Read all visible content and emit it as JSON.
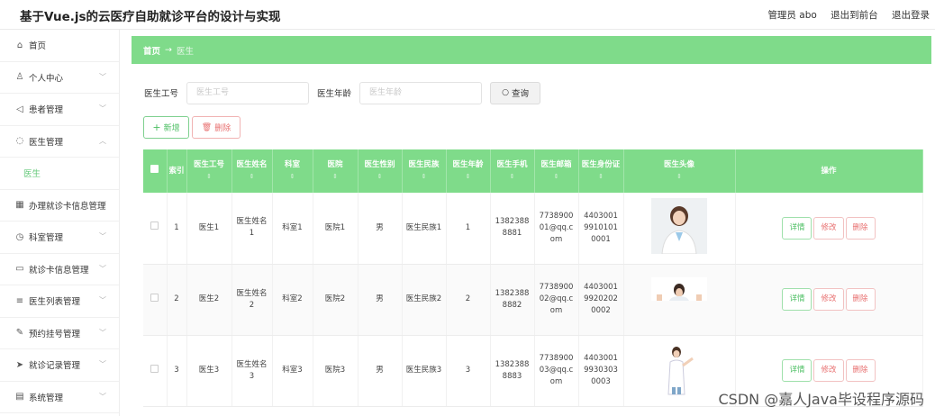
{
  "header": {
    "title": "基于Vue.js的云医疗自助就诊平台的设计与实现",
    "user": "管理员 abo",
    "back_to_front": "退出到前台",
    "logout": "退出登录"
  },
  "sidebar": {
    "items": [
      {
        "label": "首页",
        "icon": "home-icon",
        "glyph": "⌂",
        "chev": ""
      },
      {
        "label": "个人中心",
        "icon": "person-icon",
        "glyph": "♙",
        "chev": "﹀"
      },
      {
        "label": "患者管理",
        "icon": "send-icon",
        "glyph": "◁",
        "chev": "﹀"
      },
      {
        "label": "医生管理",
        "icon": "circle-icon",
        "glyph": "◌",
        "chev": "︿"
      },
      {
        "label": "医生",
        "icon": "",
        "glyph": "",
        "chev": ""
      },
      {
        "label": "办理就诊卡信息管理",
        "icon": "grid-icon",
        "glyph": "▦",
        "chev": "﹀"
      },
      {
        "label": "科室管理",
        "icon": "clock-icon",
        "glyph": "◷",
        "chev": "﹀"
      },
      {
        "label": "就诊卡信息管理",
        "icon": "card-icon",
        "glyph": "▭",
        "chev": "﹀"
      },
      {
        "label": "医生列表管理",
        "icon": "list-icon",
        "glyph": "≡",
        "chev": "﹀"
      },
      {
        "label": "预约挂号管理",
        "icon": "pen-icon",
        "glyph": "✎",
        "chev": "﹀"
      },
      {
        "label": "就诊记录管理",
        "icon": "send-icon",
        "glyph": "➤",
        "chev": "﹀"
      },
      {
        "label": "系统管理",
        "icon": "system-icon",
        "glyph": "▤",
        "chev": "﹀"
      }
    ]
  },
  "breadcrumb": {
    "home": "首页",
    "arrow": "→",
    "current": "医生"
  },
  "search": {
    "doctor_id_label": "医生工号",
    "doctor_id_placeholder": "医生工号",
    "doctor_age_label": "医生年龄",
    "doctor_age_placeholder": "医生年龄",
    "query_button": "查询"
  },
  "actions": {
    "add": "新增",
    "delete": "删除"
  },
  "table": {
    "columns": [
      "",
      "索引",
      "医生工号",
      "医生姓名",
      "科室",
      "医院",
      "医生性别",
      "医生民族",
      "医生年龄",
      "医生手机",
      "医生邮箱",
      "医生身份证",
      "医生头像",
      "操作"
    ],
    "sort_mark": "⇕",
    "rows": [
      {
        "index": "1",
        "id": "医生1",
        "name": "医生姓名1",
        "dept": "科室1",
        "hospital": "医院1",
        "gender": "男",
        "ethnicity": "医生民族1",
        "age": "1",
        "phone": "13823888881",
        "email": "773890001@qq.com",
        "idcard": "440300199101010001"
      },
      {
        "index": "2",
        "id": "医生2",
        "name": "医生姓名2",
        "dept": "科室2",
        "hospital": "医院2",
        "gender": "男",
        "ethnicity": "医生民族2",
        "age": "2",
        "phone": "13823888882",
        "email": "773890002@qq.com",
        "idcard": "440300199202020002"
      },
      {
        "index": "3",
        "id": "医生3",
        "name": "医生姓名3",
        "dept": "科室3",
        "hospital": "医院3",
        "gender": "男",
        "ethnicity": "医生民族3",
        "age": "3",
        "phone": "13823888883",
        "email": "773890003@qq.com",
        "idcard": "440300199303030003"
      }
    ],
    "op_detail": "详情",
    "op_edit": "修改",
    "op_delete": "删除"
  },
  "watermark": "CSDN @嘉人Java毕设程序源码",
  "colors": {
    "accent": "#7fdb8a",
    "danger": "#e87070",
    "primary_text": "#4cbf63"
  }
}
